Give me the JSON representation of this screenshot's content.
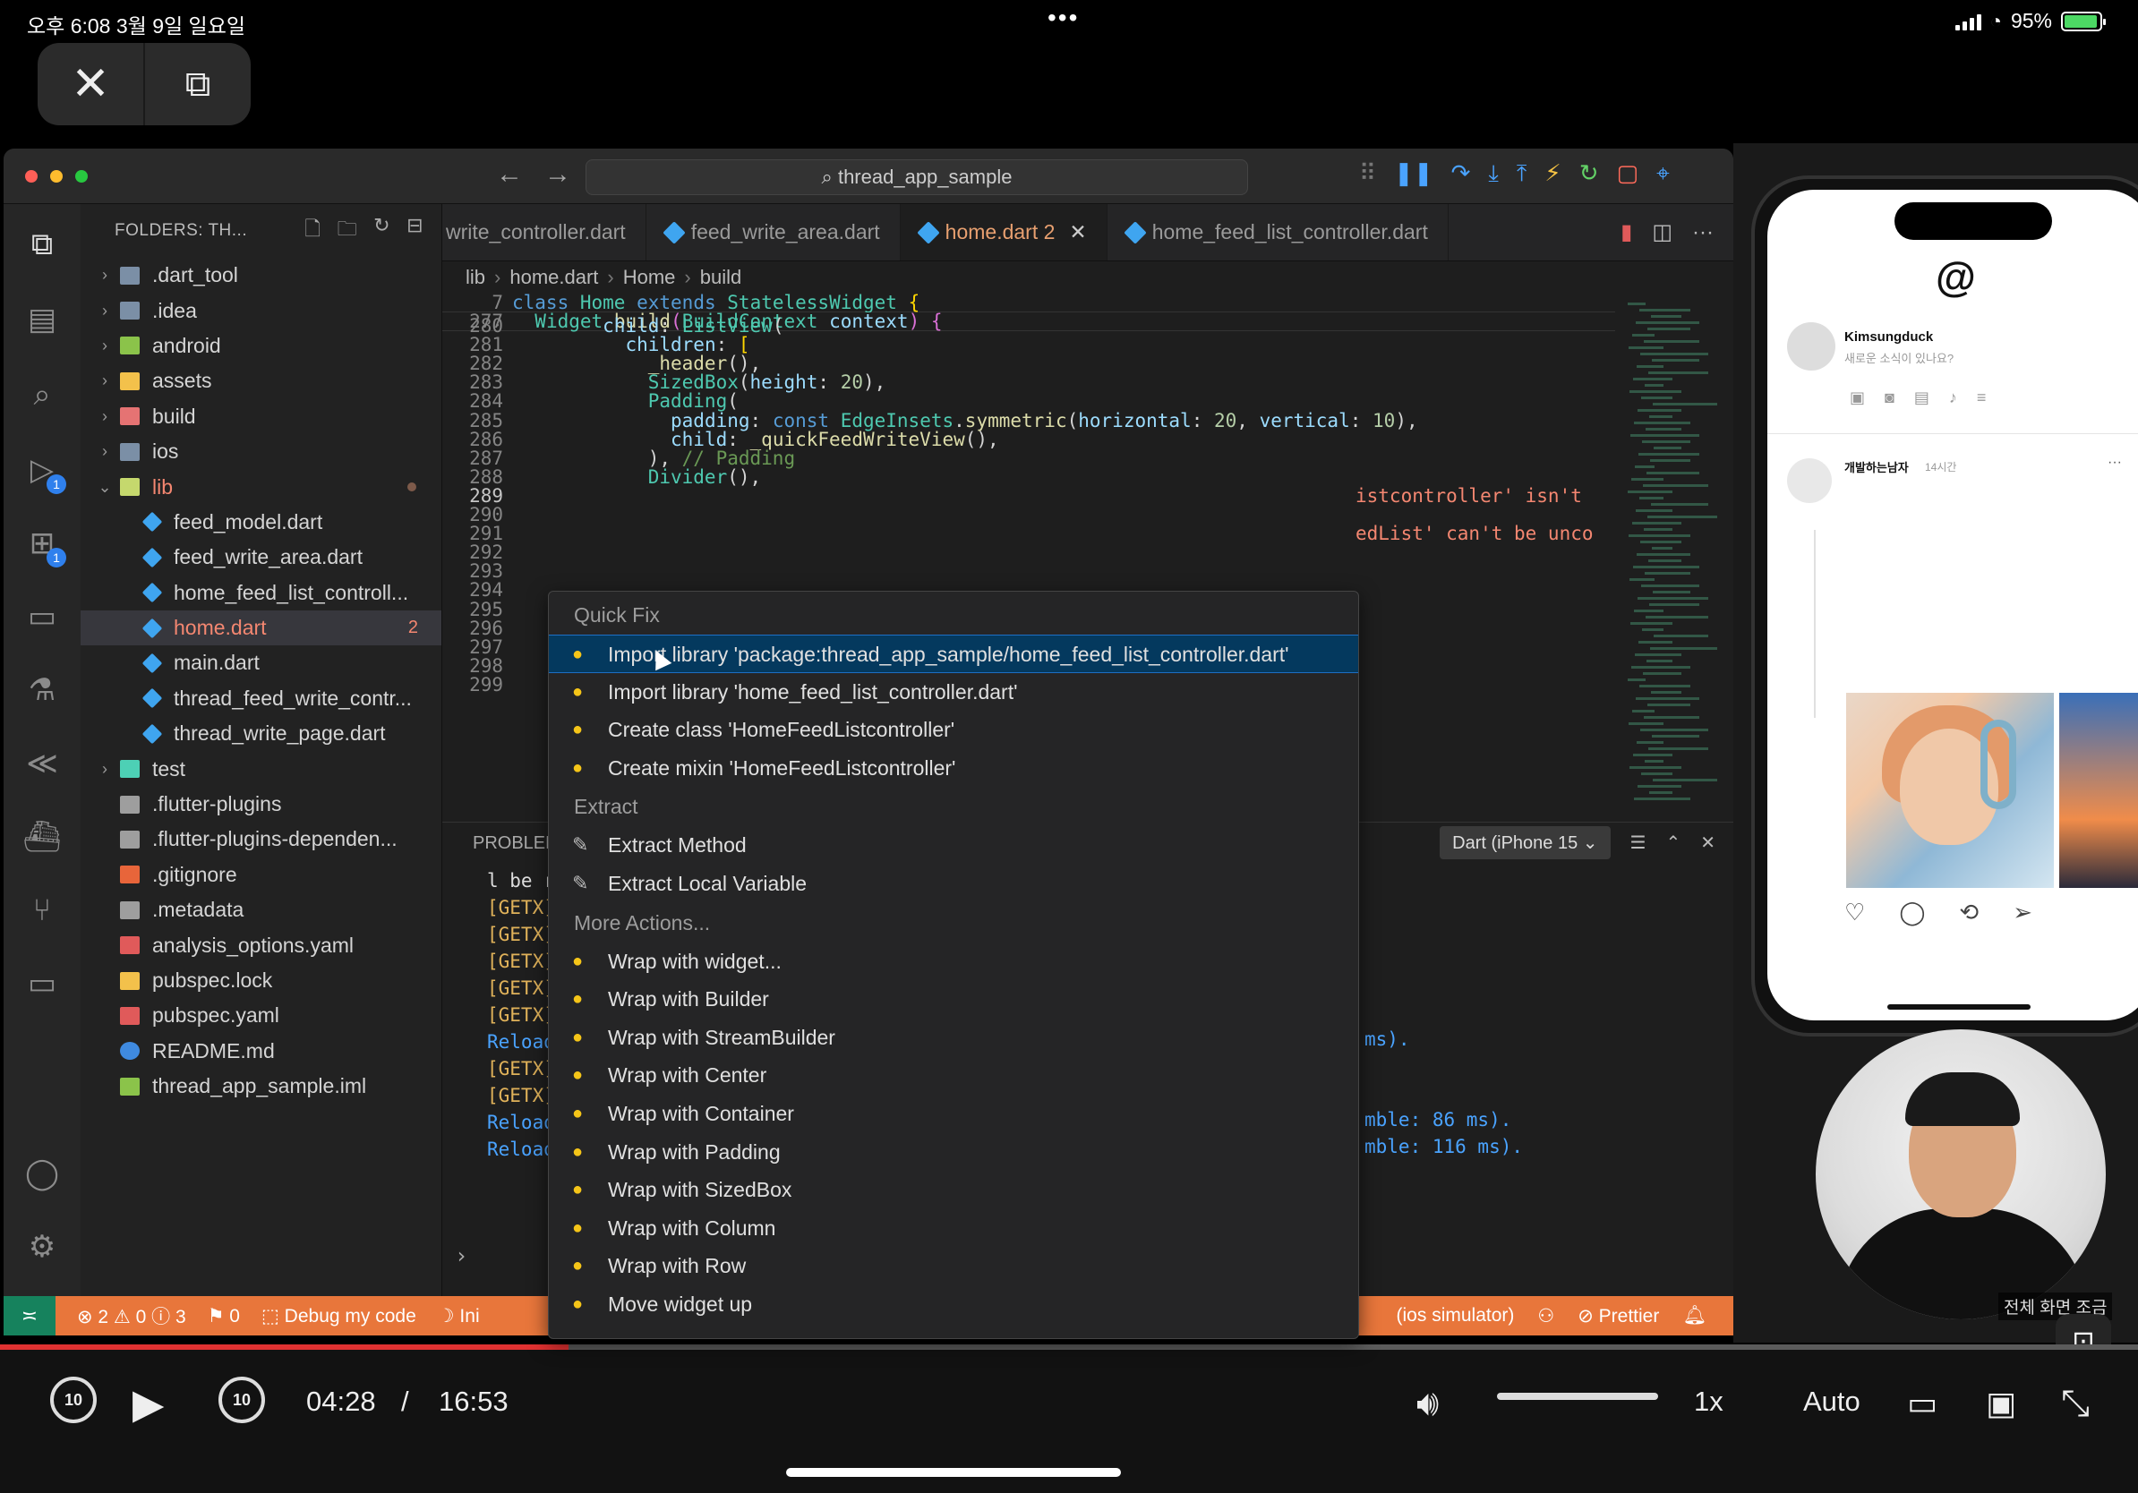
{
  "status_bar": {
    "time_date": "오후 6:08   3월 9일 일요일",
    "dots": "•••",
    "battery_pct": "95%",
    "battery_level": 0.95
  },
  "pip": {
    "close_icon": "close-icon",
    "pip_icon": "picture-in-picture-icon"
  },
  "vscode": {
    "title_search": "⌕ thread_app_sample",
    "sidebar": {
      "header": "FOLDERS: TH...",
      "items": [
        {
          "label": ".dart_tool",
          "kind": "folder",
          "chev": "›",
          "indent": 0,
          "color": "#7b8fa6"
        },
        {
          "label": ".idea",
          "kind": "folder",
          "chev": "›",
          "indent": 0,
          "color": "#7b8fa6"
        },
        {
          "label": "android",
          "kind": "folder",
          "chev": "›",
          "indent": 0,
          "color": "#8bc34a"
        },
        {
          "label": "assets",
          "kind": "folder",
          "chev": "›",
          "indent": 0,
          "color": "#f3c14b"
        },
        {
          "label": "build",
          "kind": "folder",
          "chev": "›",
          "indent": 0,
          "color": "#e57373"
        },
        {
          "label": "ios",
          "kind": "folder",
          "chev": "›",
          "indent": 0,
          "color": "#7b8fa6"
        },
        {
          "label": "lib",
          "kind": "folder",
          "chev": "⌄",
          "indent": 0,
          "color": "#c5d86d",
          "error": true,
          "dot": true
        },
        {
          "label": "feed_model.dart",
          "kind": "dart",
          "chev": "",
          "indent": 1,
          "color": "#3fa5f0"
        },
        {
          "label": "feed_write_area.dart",
          "kind": "dart",
          "chev": "",
          "indent": 1,
          "color": "#3fa5f0"
        },
        {
          "label": "home_feed_list_controll...",
          "kind": "dart",
          "chev": "",
          "indent": 1,
          "color": "#3fa5f0"
        },
        {
          "label": "home.dart",
          "kind": "dart",
          "chev": "",
          "indent": 1,
          "color": "#3fa5f0",
          "error": true,
          "selected": true,
          "count": "2"
        },
        {
          "label": "main.dart",
          "kind": "dart",
          "chev": "",
          "indent": 1,
          "color": "#3fa5f0"
        },
        {
          "label": "thread_feed_write_contr...",
          "kind": "dart",
          "chev": "",
          "indent": 1,
          "color": "#3fa5f0"
        },
        {
          "label": "thread_write_page.dart",
          "kind": "dart",
          "chev": "",
          "indent": 1,
          "color": "#3fa5f0"
        },
        {
          "label": "test",
          "kind": "folder",
          "chev": "›",
          "indent": 0,
          "color": "#4dd0b5"
        },
        {
          "label": ".flutter-plugins",
          "kind": "file",
          "chev": "",
          "indent": 0,
          "color": "#9e9e9e"
        },
        {
          "label": ".flutter-plugins-dependen...",
          "kind": "file",
          "chev": "",
          "indent": 0,
          "color": "#9e9e9e"
        },
        {
          "label": ".gitignore",
          "kind": "git",
          "chev": "",
          "indent": 0,
          "color": "#e8653a"
        },
        {
          "label": ".metadata",
          "kind": "file",
          "chev": "",
          "indent": 0,
          "color": "#9e9e9e"
        },
        {
          "label": "analysis_options.yaml",
          "kind": "yaml",
          "chev": "",
          "indent": 0,
          "color": "#e05a5a"
        },
        {
          "label": "pubspec.lock",
          "kind": "lock",
          "chev": "",
          "indent": 0,
          "color": "#f3c14b"
        },
        {
          "label": "pubspec.yaml",
          "kind": "yaml",
          "chev": "",
          "indent": 0,
          "color": "#e05a5a"
        },
        {
          "label": "README.md",
          "kind": "info",
          "chev": "",
          "indent": 0,
          "color": "#3f8ae0"
        },
        {
          "label": "thread_app_sample.iml",
          "kind": "iml",
          "chev": "",
          "indent": 0,
          "color": "#8bc34a"
        }
      ]
    },
    "tabs": [
      {
        "label": "write_controller.dart",
        "active": false,
        "dart": false
      },
      {
        "label": "feed_write_area.dart",
        "active": false,
        "dart": true
      },
      {
        "label": "home.dart 2",
        "active": true,
        "dart": true
      },
      {
        "label": "home_feed_list_controller.dart",
        "active": false,
        "dart": true
      }
    ],
    "breadcrumb": [
      "lib",
      "›",
      "home.dart",
      "›",
      "Home",
      "›",
      "build"
    ],
    "code_lines": [
      {
        "ln": "7",
        "html": "<span class=\"kw\">class</span> <span class=\"ty\">Home</span> <span class=\"kw\">extends</span> <span class=\"ty\">StatelessWidget</span> <span class=\"br\">{</span>",
        "sticky": true
      },
      {
        "ln": "277",
        "html": "  <span class=\"ty\">Widget</span> <span class=\"fn\">build</span><span class=\"br2\">(</span><span class=\"ty\">BuildContext</span> <span class=\"pr\">context</span><span class=\"br2\">)</span> <span class=\"br2\">{</span>",
        "sticky": true
      },
      {
        "ln": "280",
        "html": "        <span class=\"pr\">child</span>: <span class=\"ty\">ListView</span>("
      },
      {
        "ln": "281",
        "html": "          <span class=\"pr\">children</span>: <span class=\"br\">[</span>"
      },
      {
        "ln": "282",
        "html": "            <span class=\"fn\">_header</span>(),"
      },
      {
        "ln": "283",
        "html": "            <span class=\"ty\">SizedBox</span>(<span class=\"pr\">height</span>: <span class=\"nu\">20</span>),"
      },
      {
        "ln": "284",
        "html": "            <span class=\"ty\">Padding</span>("
      },
      {
        "ln": "285",
        "html": "              <span class=\"pr\">padding</span>: <span class=\"kw\">const</span> <span class=\"ty\">EdgeInsets</span>.<span class=\"fn\">symmetric</span>(<span class=\"pr\">horizontal</span>: <span class=\"nu\">20</span>, <span class=\"pr\">vertical</span>: <span class=\"nu\">10</span>),"
      },
      {
        "ln": "286",
        "html": "              <span class=\"pr\">child</span>: <span class=\"fn\">_quickFeedWriteView</span>(),"
      },
      {
        "ln": "287",
        "html": "            ), <span class=\"cm\">// Padding</span>"
      },
      {
        "ln": "288",
        "html": "            <span class=\"ty\">Divider</span>(),"
      },
      {
        "ln": "289",
        "html": "",
        "cur": true,
        "err": "istcontroller' isn't"
      },
      {
        "ln": "290",
        "html": ""
      },
      {
        "ln": "291",
        "html": "",
        "err": "edList' can't be unco"
      },
      {
        "ln": "292",
        "html": ""
      },
      {
        "ln": "293",
        "html": ""
      },
      {
        "ln": "294",
        "html": ""
      },
      {
        "ln": "295",
        "html": ""
      },
      {
        "ln": "296",
        "html": ""
      },
      {
        "ln": "297",
        "html": ""
      },
      {
        "ln": "298",
        "html": ""
      },
      {
        "ln": "299",
        "html": ""
      }
    ],
    "panel": {
      "tab": "PROBLEMS",
      "dropdown": "Dart (iPhone 15 ⌄",
      "lines": [
        {
          "t": "l be r",
          "cls": ""
        },
        {
          "t": "[GETX]",
          "cls": "getx"
        },
        {
          "t": "[GETX]",
          "cls": "getx"
        },
        {
          "t": "[GETX]",
          "cls": "getx"
        },
        {
          "t": "[GETX]",
          "cls": "getx"
        },
        {
          "t": "[GETX]",
          "cls": "getx"
        },
        {
          "t": "Reload",
          "cls": "reload"
        },
        {
          "t": "[GETX]",
          "cls": "getx"
        },
        {
          "t": "[GETX]",
          "cls": "getx"
        },
        {
          "t": "Reload",
          "cls": "reload"
        },
        {
          "t": "Reload",
          "cls": "reload"
        }
      ],
      "right_lines": [
        {
          "t": "ms).",
          "row": 6
        },
        {
          "t": "mble: 86 ms).",
          "row": 9
        },
        {
          "t": "mble: 116 ms).",
          "row": 10
        }
      ],
      "prompt": "›"
    },
    "status": {
      "remote": "≍",
      "problems": "⊗ 2 ⚠ 0 ⓘ 3",
      "ports": "⚑ 0",
      "debug": "Debug my code",
      "ini": "☽ Ini",
      "device": "(ios simulator)",
      "prettier": "⊘ Prettier",
      "bell": "🔔"
    }
  },
  "quickfix": {
    "sections": [
      {
        "title": "Quick Fix",
        "items": [
          {
            "label": "Import library 'package:thread_app_sample/home_feed_list_controller.dart'",
            "icon": "bulb",
            "selected": true
          },
          {
            "label": "Import library 'home_feed_list_controller.dart'",
            "icon": "bulb"
          },
          {
            "label": "Create class 'HomeFeedListcontroller'",
            "icon": "bulb"
          },
          {
            "label": "Create mixin 'HomeFeedListcontroller'",
            "icon": "bulb"
          }
        ]
      },
      {
        "title": "Extract",
        "items": [
          {
            "label": "Extract Method",
            "icon": "wrench"
          },
          {
            "label": "Extract Local Variable",
            "icon": "wrench"
          }
        ]
      },
      {
        "title": "More Actions...",
        "items": [
          {
            "label": "Wrap with widget...",
            "icon": "bulb"
          },
          {
            "label": "Wrap with Builder",
            "icon": "bulb"
          },
          {
            "label": "Wrap with StreamBuilder",
            "icon": "bulb"
          },
          {
            "label": "Wrap with Center",
            "icon": "bulb"
          },
          {
            "label": "Wrap with Container",
            "icon": "bulb"
          },
          {
            "label": "Wrap with Padding",
            "icon": "bulb"
          },
          {
            "label": "Wrap with SizedBox",
            "icon": "bulb"
          },
          {
            "label": "Wrap with Column",
            "icon": "bulb"
          },
          {
            "label": "Wrap with Row",
            "icon": "bulb"
          },
          {
            "label": "Move widget up",
            "icon": "bulb"
          }
        ]
      }
    ]
  },
  "phone": {
    "logo": "@",
    "user": "Kimsungduck",
    "prompt": "새로운 소식이 있나요?",
    "post_user": "개발하는남자",
    "post_time": "14시간",
    "post_more": "···"
  },
  "overlay": {
    "fullscreen_label": "전체 화면 조금",
    "textscan_icon": "live-text-icon"
  },
  "player": {
    "progress": 0.266,
    "current": "04:28",
    "sep": "/",
    "duration": "16:53",
    "skip_back": "10",
    "skip_fwd": "10",
    "speed": "1x",
    "quality": "Auto"
  }
}
